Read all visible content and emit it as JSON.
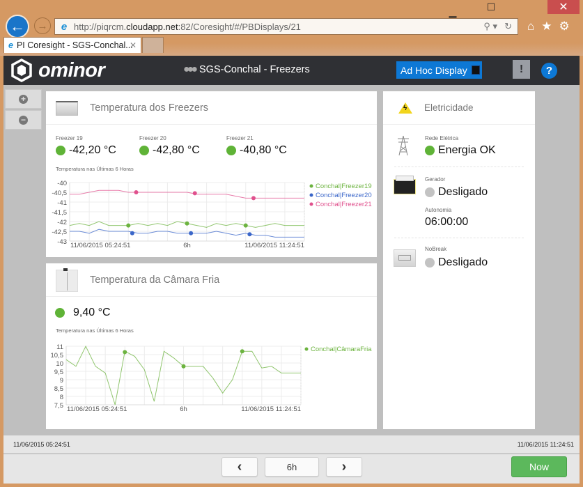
{
  "browser": {
    "url_prefix": "http://piqrcm.",
    "url_host": "cloudapp.net",
    "url_suffix": ":82/Coresight/#/PBDisplays/21",
    "tab_title": "PI Coresight - SGS-Conchal...",
    "close_glyph": "✕",
    "minimize_glyph": "▁",
    "maximize_glyph": "☐",
    "back_glyph": "←",
    "forward_glyph": "→",
    "search_glyph": "⚲ ▾",
    "refresh_glyph": "↻",
    "home_glyph": "⌂",
    "favorites_glyph": "★",
    "settings_glyph": "⚙",
    "tab_close_glyph": "✕"
  },
  "header": {
    "brand": "ominor",
    "display_title": "SGS-Conchal - Freezers",
    "adhoc_label": "Ad Hoc Display",
    "alert_glyph": "!",
    "help_glyph": "?"
  },
  "zoom_controls": {
    "plus": "+",
    "minus": "−"
  },
  "freezers": {
    "title": "Temperatura dos Freezers",
    "items": [
      {
        "label": "Freezer 19",
        "value": "-42,20 °C",
        "status": "green"
      },
      {
        "label": "Freezer 20",
        "value": "-42,80 °C",
        "status": "green"
      },
      {
        "label": "Freezer 21",
        "value": "-40,80 °C",
        "status": "green"
      }
    ],
    "chart_caption": "Temperatura nas Últimas 6 Horas"
  },
  "camara": {
    "title": "Temperatura da Câmara Fria",
    "value": "9,40 °C",
    "status": "green",
    "chart_caption": "Temperatura nas Últimas 6 Horas"
  },
  "eletricidade": {
    "title": "Eletricidade",
    "rede_label": "Rede Elétrica",
    "rede_value": "Energia OK",
    "gerador_label": "Gerador",
    "gerador_value": "Desligado",
    "autonomia_label": "Autonomia",
    "autonomia_value": "06:00:00",
    "nobreak_label": "NoBreak",
    "nobreak_value": "Desligado"
  },
  "timebar": {
    "start": "11/06/2015 05:24:51",
    "end": "11/06/2015 11:24:51",
    "prev_glyph": "‹",
    "duration": "6h",
    "next_glyph": "›",
    "now_label": "Now"
  },
  "chart_data": [
    {
      "type": "line",
      "title": "Temperatura nas Últimas 6 Horas",
      "ylim": [
        -43,
        -40
      ],
      "yticks": [
        "-40",
        "-40,5",
        "-41",
        "-41,5",
        "-42",
        "-42,5",
        "-43"
      ],
      "xticks": [
        "11/06/2015 05:24:51",
        "6h",
        "11/06/2015 11:24:51"
      ],
      "x_hours": [
        0,
        0.25,
        0.5,
        0.75,
        1,
        1.25,
        1.5,
        1.75,
        2,
        2.25,
        2.5,
        2.75,
        3,
        3.25,
        3.5,
        3.75,
        4,
        4.25,
        4.5,
        4.75,
        5,
        5.25,
        5.5,
        5.75,
        6
      ],
      "legend": "right",
      "grid": true,
      "series": [
        {
          "name": "Conchal|Freezer19",
          "color": "#6cb33f",
          "values": [
            -42.2,
            -42.1,
            -42.2,
            -42.0,
            -42.2,
            -42.2,
            -42.2,
            -42.1,
            -42.2,
            -42.1,
            -42.2,
            -42.0,
            -42.1,
            -42.2,
            -42.3,
            -42.1,
            -42.2,
            -42.1,
            -42.2,
            -42.3,
            -42.2,
            -42.1,
            -42.2,
            -42.2,
            -42.2
          ],
          "markers": [
            [
              1.5,
              -42.2
            ],
            [
              3.0,
              -42.1
            ],
            [
              4.5,
              -42.2
            ]
          ]
        },
        {
          "name": "Conchal|Freezer20",
          "color": "#3a66c9",
          "values": [
            -42.5,
            -42.5,
            -42.6,
            -42.4,
            -42.5,
            -42.5,
            -42.5,
            -42.6,
            -42.6,
            -42.5,
            -42.5,
            -42.6,
            -42.6,
            -42.6,
            -42.6,
            -42.5,
            -42.6,
            -42.7,
            -42.6,
            -42.7,
            -42.7,
            -42.8,
            -42.8,
            -42.8,
            -42.8
          ],
          "markers": [
            [
              1.6,
              -42.6
            ],
            [
              3.1,
              -42.6
            ],
            [
              4.6,
              -42.65
            ]
          ]
        },
        {
          "name": "Conchal|Freezer21",
          "color": "#e0508d",
          "values": [
            -40.6,
            -40.6,
            -40.5,
            -40.4,
            -40.4,
            -40.4,
            -40.5,
            -40.5,
            -40.5,
            -40.5,
            -40.5,
            -40.5,
            -40.5,
            -40.6,
            -40.6,
            -40.6,
            -40.6,
            -40.7,
            -40.8,
            -40.8,
            -40.8,
            -40.8,
            -40.8,
            -40.8,
            -40.8
          ],
          "markers": [
            [
              1.7,
              -40.5
            ],
            [
              3.2,
              -40.55
            ],
            [
              4.7,
              -40.8
            ]
          ]
        }
      ]
    },
    {
      "type": "line",
      "title": "Temperatura nas Últimas 6 Horas",
      "ylim": [
        7.5,
        11
      ],
      "yticks": [
        "11",
        "10,5",
        "10",
        "9,5",
        "9",
        "8,5",
        "8",
        "7,5"
      ],
      "xticks": [
        "11/06/2015 05:24:51",
        "6h",
        "11/06/2015 11:24:51"
      ],
      "x_hours": [
        0,
        0.25,
        0.5,
        0.75,
        1,
        1.25,
        1.5,
        1.75,
        2,
        2.25,
        2.5,
        2.75,
        3,
        3.25,
        3.5,
        3.75,
        4,
        4.25,
        4.5,
        4.75,
        5,
        5.25,
        5.5,
        5.75,
        6
      ],
      "legend": "right",
      "grid": true,
      "series": [
        {
          "name": "Conchal|CâmaraFria",
          "color": "#6cb33f",
          "values": [
            10.2,
            9.8,
            11.0,
            9.8,
            9.4,
            7.5,
            10.7,
            10.4,
            9.6,
            7.7,
            10.7,
            10.3,
            9.8,
            9.8,
            9.8,
            9.1,
            8.2,
            9.0,
            10.7,
            10.7,
            9.7,
            9.8,
            9.4,
            9.4,
            9.4
          ],
          "markers": [
            [
              1.5,
              10.65
            ],
            [
              3.0,
              9.8
            ],
            [
              4.5,
              10.7
            ]
          ]
        }
      ]
    }
  ]
}
